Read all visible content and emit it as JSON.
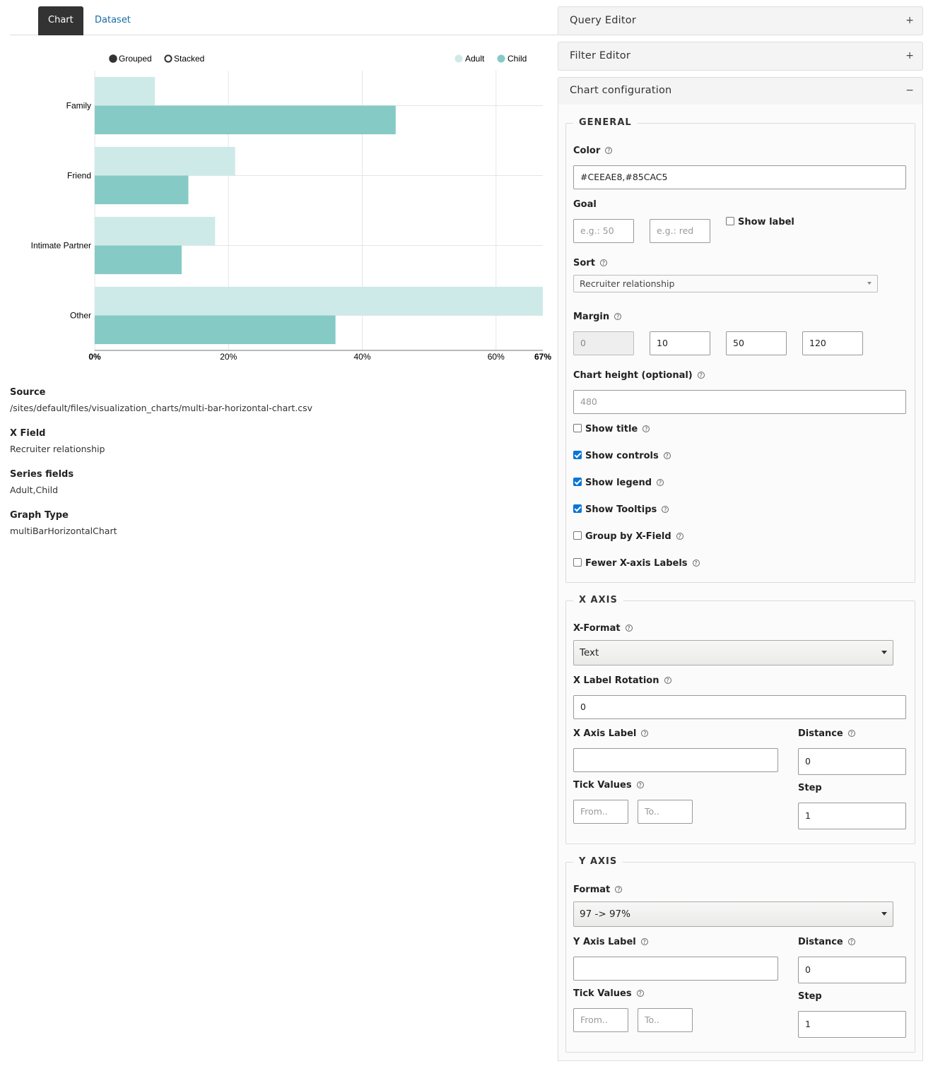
{
  "tabs": [
    {
      "label": "Chart"
    },
    {
      "label": "Dataset"
    }
  ],
  "chart_data": {
    "type": "bar",
    "orientation": "horizontal",
    "categories": [
      "Family",
      "Friend",
      "Intimate Partner",
      "Other"
    ],
    "series": [
      {
        "name": "Adult",
        "color": "#CEEAE8",
        "values": [
          9,
          21,
          18,
          67
        ]
      },
      {
        "name": "Child",
        "color": "#85CAC5",
        "values": [
          45,
          14,
          13,
          36
        ]
      }
    ],
    "xlim": [
      0,
      67
    ],
    "x_ticks": [
      {
        "v": 0,
        "label": "0%"
      },
      {
        "v": 20,
        "label": "20%"
      },
      {
        "v": 40,
        "label": "40%"
      },
      {
        "v": 60,
        "label": "60%"
      },
      {
        "v": 67,
        "label": "67%"
      }
    ],
    "controls": {
      "grouped": "Grouped",
      "stacked": "Stacked",
      "selected": "grouped"
    },
    "grid": true,
    "legend_position": "top-right"
  },
  "info": {
    "source_label": "Source",
    "source_value": "/sites/default/files/visualization_charts/multi-bar-horizontal-chart.csv",
    "xfield_label": "X Field",
    "xfield_value": "Recruiter relationship",
    "series_label": "Series fields",
    "series_value": "Adult,Child",
    "graph_label": "Graph Type",
    "graph_value": "multiBarHorizontalChart"
  },
  "panels": {
    "query_editor": "Query Editor",
    "filter_editor": "Filter Editor",
    "chart_config": "Chart configuration",
    "plus": "+",
    "minus": "−"
  },
  "general": {
    "title": "GENERAL",
    "color_label": "Color",
    "color_value": "#CEEAE8,#85CAC5",
    "goal_label": "Goal",
    "goal_placeholder_1": "e.g.: 50",
    "goal_placeholder_2": "e.g.: red",
    "show_label": "Show label",
    "sort_label": "Sort",
    "sort_value": "Recruiter relationship",
    "margin_label": "Margin",
    "margin_values": [
      "0",
      "10",
      "50",
      "120"
    ],
    "height_label": "Chart height (optional)",
    "height_placeholder": "480",
    "show_title": "Show title",
    "show_controls": "Show controls",
    "show_legend": "Show legend",
    "show_tooltips": "Show Tooltips",
    "group_by": "Group by X-Field",
    "fewer_labels": "Fewer X-axis Labels",
    "help": "?"
  },
  "xaxis": {
    "title": "X AXIS",
    "format_label": "X-Format",
    "format_value": "Text",
    "rotation_label": "X Label Rotation",
    "rotation_value": "0",
    "axis_label": "X Axis Label",
    "distance_label": "Distance",
    "distance_value": "0",
    "tick_label": "Tick Values",
    "from_placeholder": "From..",
    "to_placeholder": "To..",
    "step_label": "Step",
    "step_value": "1"
  },
  "yaxis": {
    "title": "Y AXIS",
    "format_label": "Format",
    "format_value": "97 -> 97%",
    "axis_label": "Y Axis Label",
    "distance_label": "Distance",
    "distance_value": "0",
    "tick_label": "Tick Values",
    "from_placeholder": "From..",
    "to_placeholder": "To..",
    "step_label": "Step",
    "step_value": "1"
  }
}
